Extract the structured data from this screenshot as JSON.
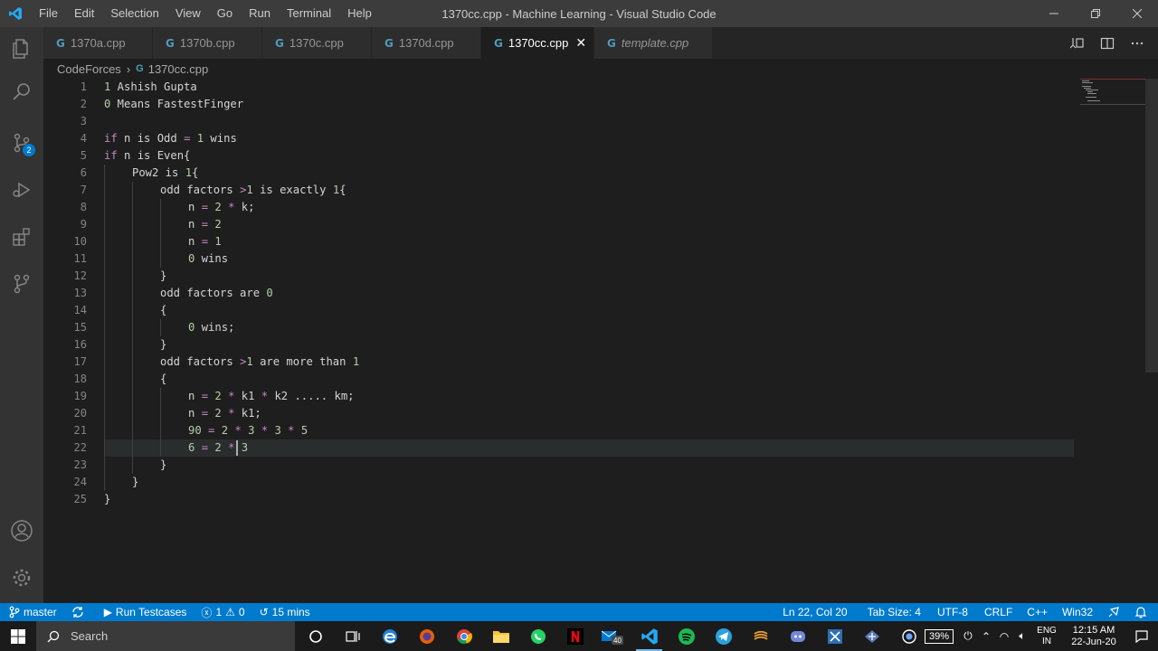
{
  "window": {
    "title": "1370cc.cpp - Machine Learning - Visual Studio Code",
    "app_icon": "vscode-icon"
  },
  "menu": [
    "File",
    "Edit",
    "Selection",
    "View",
    "Go",
    "Run",
    "Terminal",
    "Help"
  ],
  "tabs": [
    {
      "label": "1370a.cpp",
      "icon": "cpp-file-icon",
      "active": false,
      "italic": false
    },
    {
      "label": "1370b.cpp",
      "icon": "cpp-file-icon",
      "active": false,
      "italic": false
    },
    {
      "label": "1370c.cpp",
      "icon": "cpp-file-icon",
      "active": false,
      "italic": false
    },
    {
      "label": "1370d.cpp",
      "icon": "cpp-file-icon",
      "active": false,
      "italic": false
    },
    {
      "label": "1370cc.cpp",
      "icon": "cpp-file-icon",
      "active": true,
      "italic": false
    },
    {
      "label": "template.cpp",
      "icon": "cpp-file-icon",
      "active": false,
      "italic": true
    }
  ],
  "breadcrumb": {
    "folder": "CodeForces",
    "file": "1370cc.cpp"
  },
  "activity_badge": "2",
  "editor": {
    "highlighted_line": 22,
    "lines": [
      {
        "n": "1",
        "indent": 0,
        "parts": [
          [
            "num",
            "1"
          ],
          [
            "txt",
            " Ashish Gupta"
          ]
        ]
      },
      {
        "n": "2",
        "indent": 0,
        "parts": [
          [
            "num",
            "0"
          ],
          [
            "txt",
            " Means FastestFinger"
          ]
        ]
      },
      {
        "n": "3",
        "indent": 0,
        "parts": []
      },
      {
        "n": "4",
        "indent": 0,
        "parts": [
          [
            "kw",
            "if"
          ],
          [
            "txt",
            " n is Odd "
          ],
          [
            "pink",
            "="
          ],
          [
            "txt",
            " "
          ],
          [
            "num",
            "1"
          ],
          [
            "txt",
            " wins"
          ]
        ]
      },
      {
        "n": "5",
        "indent": 0,
        "parts": [
          [
            "kw",
            "if"
          ],
          [
            "txt",
            " n is Even{"
          ]
        ]
      },
      {
        "n": "6",
        "indent": 1,
        "parts": [
          [
            "txt",
            "Pow2 is "
          ],
          [
            "num",
            "1"
          ],
          [
            "txt",
            "{"
          ]
        ]
      },
      {
        "n": "7",
        "indent": 2,
        "parts": [
          [
            "txt",
            "odd factors "
          ],
          [
            "pink",
            ">"
          ],
          [
            "num",
            "1"
          ],
          [
            "txt",
            " is exactly "
          ],
          [
            "num",
            "1"
          ],
          [
            "txt",
            "{"
          ]
        ]
      },
      {
        "n": "8",
        "indent": 3,
        "parts": [
          [
            "txt",
            "n "
          ],
          [
            "pink",
            "="
          ],
          [
            "txt",
            " "
          ],
          [
            "num",
            "2"
          ],
          [
            "txt",
            " "
          ],
          [
            "pink",
            "*"
          ],
          [
            "txt",
            " k;"
          ]
        ]
      },
      {
        "n": "9",
        "indent": 3,
        "parts": [
          [
            "txt",
            "n "
          ],
          [
            "pink",
            "="
          ],
          [
            "txt",
            " "
          ],
          [
            "num",
            "2"
          ]
        ]
      },
      {
        "n": "10",
        "indent": 3,
        "parts": [
          [
            "txt",
            "n "
          ],
          [
            "pink",
            "="
          ],
          [
            "txt",
            " "
          ],
          [
            "num",
            "1"
          ]
        ]
      },
      {
        "n": "11",
        "indent": 3,
        "parts": [
          [
            "num",
            "0"
          ],
          [
            "txt",
            " wins"
          ]
        ]
      },
      {
        "n": "12",
        "indent": 2,
        "parts": [
          [
            "txt",
            "}"
          ]
        ]
      },
      {
        "n": "13",
        "indent": 2,
        "parts": [
          [
            "txt",
            "odd factors are "
          ],
          [
            "num",
            "0"
          ]
        ]
      },
      {
        "n": "14",
        "indent": 2,
        "parts": [
          [
            "txt",
            "{"
          ]
        ]
      },
      {
        "n": "15",
        "indent": 3,
        "parts": [
          [
            "num",
            "0"
          ],
          [
            "txt",
            " wins;"
          ]
        ]
      },
      {
        "n": "16",
        "indent": 2,
        "parts": [
          [
            "txt",
            "}"
          ]
        ]
      },
      {
        "n": "17",
        "indent": 2,
        "parts": [
          [
            "txt",
            "odd factors "
          ],
          [
            "pink",
            ">"
          ],
          [
            "num",
            "1"
          ],
          [
            "txt",
            " are more than "
          ],
          [
            "num",
            "1"
          ]
        ]
      },
      {
        "n": "18",
        "indent": 2,
        "parts": [
          [
            "txt",
            "{"
          ]
        ]
      },
      {
        "n": "19",
        "indent": 3,
        "parts": [
          [
            "txt",
            "n "
          ],
          [
            "pink",
            "="
          ],
          [
            "txt",
            " "
          ],
          [
            "num",
            "2"
          ],
          [
            "txt",
            " "
          ],
          [
            "pink",
            "*"
          ],
          [
            "txt",
            " k1 "
          ],
          [
            "pink",
            "*"
          ],
          [
            "txt",
            " k2 ..... km;"
          ]
        ]
      },
      {
        "n": "20",
        "indent": 3,
        "parts": [
          [
            "txt",
            "n "
          ],
          [
            "pink",
            "="
          ],
          [
            "txt",
            " "
          ],
          [
            "num",
            "2"
          ],
          [
            "txt",
            " "
          ],
          [
            "pink",
            "*"
          ],
          [
            "txt",
            " k1;"
          ]
        ]
      },
      {
        "n": "21",
        "indent": 3,
        "parts": [
          [
            "num",
            "90"
          ],
          [
            "txt",
            " "
          ],
          [
            "pink",
            "="
          ],
          [
            "txt",
            " "
          ],
          [
            "num",
            "2"
          ],
          [
            "txt",
            " "
          ],
          [
            "pink",
            "*"
          ],
          [
            "txt",
            " "
          ],
          [
            "num",
            "3"
          ],
          [
            "txt",
            " "
          ],
          [
            "pink",
            "*"
          ],
          [
            "txt",
            " "
          ],
          [
            "num",
            "3"
          ],
          [
            "txt",
            " "
          ],
          [
            "pink",
            "*"
          ],
          [
            "txt",
            " "
          ],
          [
            "num",
            "5"
          ]
        ]
      },
      {
        "n": "22",
        "indent": 3,
        "parts": [
          [
            "num",
            "6"
          ],
          [
            "txt",
            " "
          ],
          [
            "pink",
            "="
          ],
          [
            "txt",
            " "
          ],
          [
            "num",
            "2"
          ],
          [
            "txt",
            " "
          ],
          [
            "pink",
            "*"
          ],
          [
            "txt",
            " "
          ],
          [
            "num",
            "3"
          ]
        ]
      },
      {
        "n": "23",
        "indent": 2,
        "parts": [
          [
            "txt",
            "}"
          ]
        ]
      },
      {
        "n": "24",
        "indent": 1,
        "parts": [
          [
            "txt",
            "}"
          ]
        ]
      },
      {
        "n": "25",
        "indent": 0,
        "parts": [
          [
            "txt",
            "}"
          ]
        ]
      }
    ]
  },
  "statusbar": {
    "branch": "master",
    "run_testcases": "Run Testcases",
    "errors": "1",
    "warnings": "0",
    "time": "15 mins",
    "position": "Ln 22, Col 20",
    "tab_size": "Tab Size: 4",
    "encoding": "UTF-8",
    "eol": "CRLF",
    "language": "C++",
    "platform": "Win32"
  },
  "taskbar": {
    "search_placeholder": "Search",
    "mail_badge": "40",
    "battery": "39%",
    "lang_top": "ENG",
    "lang_bottom": "IN",
    "clock_time": "12:15 AM",
    "clock_date": "22-Jun-20"
  },
  "colors": {
    "accent": "#007acc",
    "keyword": "#c586c0",
    "number": "#b5cea8"
  }
}
